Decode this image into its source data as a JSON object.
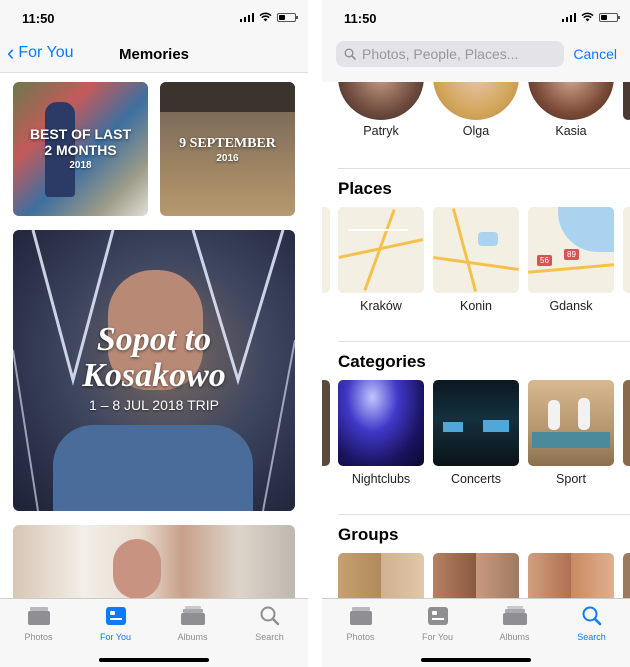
{
  "left": {
    "status_time": "11:50",
    "nav": {
      "back_label": "For You",
      "title": "Memories"
    },
    "memories": [
      {
        "title": "BEST OF LAST\n2 MONTHS",
        "subtitle": "2018"
      },
      {
        "title": "9 SEPTEMBER",
        "subtitle": "2016"
      },
      {
        "title": "Sopot to\nKosakowo",
        "subtitle": "1 – 8 JUL 2018 TRIP"
      }
    ],
    "tabbar": [
      {
        "label": "Photos",
        "icon": "photos-icon",
        "active": false
      },
      {
        "label": "For You",
        "icon": "for-you-icon",
        "active": true
      },
      {
        "label": "Albums",
        "icon": "albums-icon",
        "active": false
      },
      {
        "label": "Search",
        "icon": "search-icon",
        "active": false
      }
    ]
  },
  "right": {
    "status_time": "11:50",
    "search": {
      "placeholder": "Photos, People, Places...",
      "cancel_label": "Cancel"
    },
    "people": [
      {
        "name": "Patryk"
      },
      {
        "name": "Olga"
      },
      {
        "name": "Kasia"
      }
    ],
    "places_title": "Places",
    "places": [
      {
        "name": "Kraków"
      },
      {
        "name": "Konin"
      },
      {
        "name": "Gdansk",
        "road_badges": [
          "56",
          "89"
        ]
      }
    ],
    "categories_title": "Categories",
    "categories": [
      {
        "name": "Nightclubs"
      },
      {
        "name": "Concerts"
      },
      {
        "name": "Sport"
      }
    ],
    "groups_title": "Groups",
    "tabbar": [
      {
        "label": "Photos",
        "icon": "photos-icon",
        "active": false
      },
      {
        "label": "For You",
        "icon": "for-you-icon",
        "active": false
      },
      {
        "label": "Albums",
        "icon": "albums-icon",
        "active": false
      },
      {
        "label": "Search",
        "icon": "search-icon",
        "active": true
      }
    ]
  },
  "colors": {
    "accent": "#0a7aff",
    "inactive": "#8e8e93"
  }
}
